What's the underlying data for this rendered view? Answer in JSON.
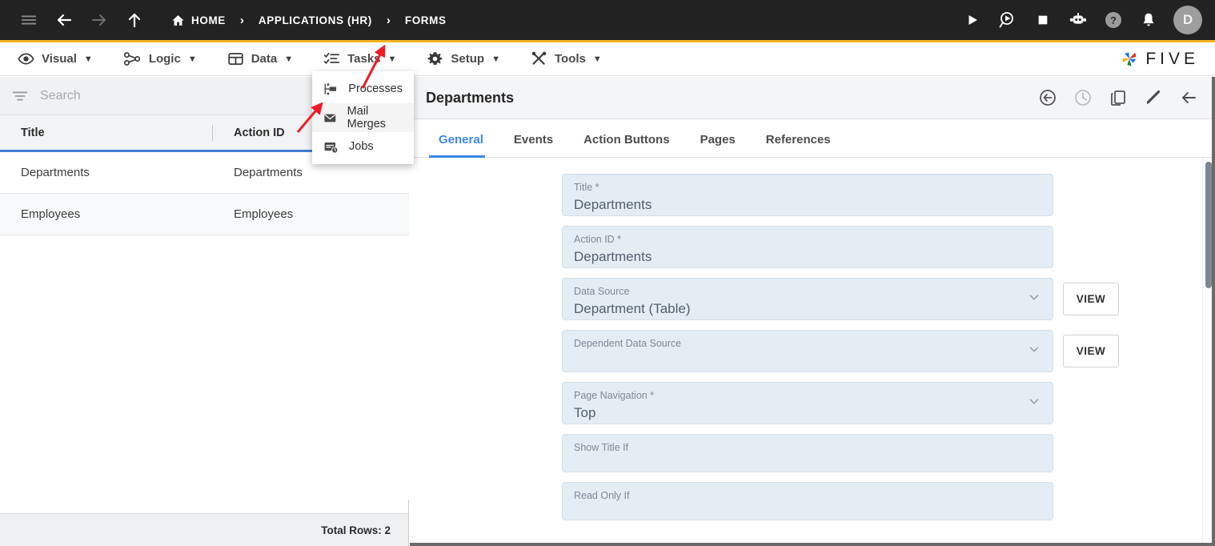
{
  "topbar": {
    "nav": [
      {
        "name": "menu-icon",
        "label": "Menu"
      },
      {
        "name": "back-icon",
        "label": "Back"
      },
      {
        "name": "forward-icon",
        "label": "Forward"
      },
      {
        "name": "up-icon",
        "label": "Up"
      }
    ],
    "breadcrumbs": [
      {
        "label": "HOME",
        "icon": "home-icon"
      },
      {
        "label": "APPLICATIONS (HR)",
        "icon": ""
      },
      {
        "label": "FORMS",
        "icon": ""
      }
    ],
    "separator": "›",
    "right_icons": [
      {
        "name": "run-icon",
        "label": "Run"
      },
      {
        "name": "debug-icon",
        "label": "Debug"
      },
      {
        "name": "stop-icon",
        "label": "Stop"
      },
      {
        "name": "robot-icon",
        "label": "Assistant"
      },
      {
        "name": "help-icon",
        "label": "Help"
      },
      {
        "name": "notifications-icon",
        "label": "Notifications"
      }
    ],
    "avatar_initial": "D"
  },
  "menubar": {
    "items": [
      {
        "label": "Visual",
        "icon": "eye-icon",
        "caret": "▼"
      },
      {
        "label": "Logic",
        "icon": "logic-icon",
        "caret": "▼"
      },
      {
        "label": "Data",
        "icon": "table-icon",
        "caret": "▼"
      },
      {
        "label": "Tasks",
        "icon": "tasks-icon",
        "caret": "▼"
      },
      {
        "label": "Setup",
        "icon": "gear-icon",
        "caret": "▼"
      },
      {
        "label": "Tools",
        "icon": "tools-icon",
        "caret": "▼"
      }
    ],
    "brand": "FIVE"
  },
  "dropdown": {
    "open_for": "Tasks",
    "items": [
      {
        "label": "Processes",
        "icon": "processes-icon",
        "highlighted": false
      },
      {
        "label": "Mail Merges",
        "icon": "mail-icon",
        "highlighted": true
      },
      {
        "label": "Jobs",
        "icon": "jobs-icon",
        "highlighted": false
      }
    ]
  },
  "left_panel": {
    "search": {
      "value": "",
      "placeholder": "Search",
      "icon": "filter-icon"
    },
    "table": {
      "columns": [
        "Title",
        "Action ID"
      ],
      "rows": [
        [
          "Departments",
          "Departments"
        ],
        [
          "Employees",
          "Employees"
        ]
      ]
    },
    "footer": "Total Rows: 2"
  },
  "detail": {
    "title": "Departments",
    "actions": [
      {
        "name": "undo-icon",
        "label": "Undo"
      },
      {
        "name": "history-clock-icon",
        "label": "History"
      },
      {
        "name": "copy-icon",
        "label": "Copy"
      },
      {
        "name": "edit-pencil-icon",
        "label": "Edit"
      },
      {
        "name": "back-arrow-icon",
        "label": "Back"
      }
    ],
    "tabs": [
      {
        "label": "General",
        "active": true
      },
      {
        "label": "Events",
        "active": false
      },
      {
        "label": "Action Buttons",
        "active": false
      },
      {
        "label": "Pages",
        "active": false
      },
      {
        "label": "References",
        "active": false
      }
    ],
    "fields": [
      {
        "label": "Title *",
        "value": "Departments",
        "type": "text",
        "view_button": null
      },
      {
        "label": "Action ID *",
        "value": "Departments",
        "type": "text",
        "view_button": null
      },
      {
        "label": "Data Source",
        "value": "Department (Table)",
        "type": "select",
        "view_button": "VIEW"
      },
      {
        "label": "Dependent Data Source",
        "value": "",
        "type": "select",
        "view_button": "VIEW"
      },
      {
        "label": "Page Navigation *",
        "value": "Top",
        "type": "select",
        "view_button": null
      },
      {
        "label": "Show Title If",
        "value": "",
        "type": "text",
        "view_button": null
      },
      {
        "label": "Read Only If",
        "value": "",
        "type": "text",
        "view_button": null
      }
    ]
  },
  "colors": {
    "topbar_bg": "#222222",
    "accent_yellow": "#f5b325",
    "tab_active_blue": "#3b87e8",
    "table_header_underline": "#3e7fd1",
    "field_bg": "#e4ecf4",
    "annotation_red": "#ee1c25"
  },
  "annotations": [
    {
      "name": "arrow-to-tasks-menu",
      "target": "Tasks"
    },
    {
      "name": "arrow-to-mail-merges",
      "target": "Mail Merges"
    }
  ]
}
